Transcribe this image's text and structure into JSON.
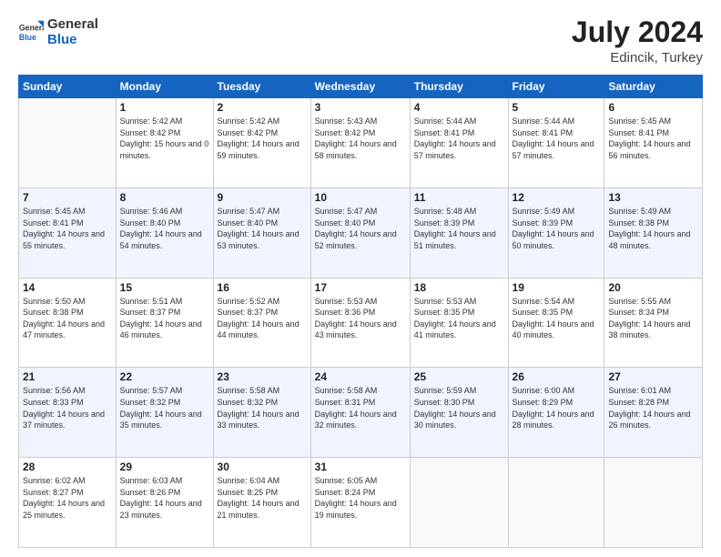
{
  "header": {
    "logo_general": "General",
    "logo_blue": "Blue",
    "month_year": "July 2024",
    "location": "Edincik, Turkey"
  },
  "weekdays": [
    "Sunday",
    "Monday",
    "Tuesday",
    "Wednesday",
    "Thursday",
    "Friday",
    "Saturday"
  ],
  "weeks": [
    [
      {
        "day": "",
        "sunrise": "",
        "sunset": "",
        "daylight": ""
      },
      {
        "day": "1",
        "sunrise": "5:42 AM",
        "sunset": "8:42 PM",
        "daylight": "15 hours and 0 minutes."
      },
      {
        "day": "2",
        "sunrise": "5:42 AM",
        "sunset": "8:42 PM",
        "daylight": "14 hours and 59 minutes."
      },
      {
        "day": "3",
        "sunrise": "5:43 AM",
        "sunset": "8:42 PM",
        "daylight": "14 hours and 58 minutes."
      },
      {
        "day": "4",
        "sunrise": "5:44 AM",
        "sunset": "8:41 PM",
        "daylight": "14 hours and 57 minutes."
      },
      {
        "day": "5",
        "sunrise": "5:44 AM",
        "sunset": "8:41 PM",
        "daylight": "14 hours and 57 minutes."
      },
      {
        "day": "6",
        "sunrise": "5:45 AM",
        "sunset": "8:41 PM",
        "daylight": "14 hours and 56 minutes."
      }
    ],
    [
      {
        "day": "7",
        "sunrise": "5:45 AM",
        "sunset": "8:41 PM",
        "daylight": "14 hours and 55 minutes."
      },
      {
        "day": "8",
        "sunrise": "5:46 AM",
        "sunset": "8:40 PM",
        "daylight": "14 hours and 54 minutes."
      },
      {
        "day": "9",
        "sunrise": "5:47 AM",
        "sunset": "8:40 PM",
        "daylight": "14 hours and 53 minutes."
      },
      {
        "day": "10",
        "sunrise": "5:47 AM",
        "sunset": "8:40 PM",
        "daylight": "14 hours and 52 minutes."
      },
      {
        "day": "11",
        "sunrise": "5:48 AM",
        "sunset": "8:39 PM",
        "daylight": "14 hours and 51 minutes."
      },
      {
        "day": "12",
        "sunrise": "5:49 AM",
        "sunset": "8:39 PM",
        "daylight": "14 hours and 50 minutes."
      },
      {
        "day": "13",
        "sunrise": "5:49 AM",
        "sunset": "8:38 PM",
        "daylight": "14 hours and 48 minutes."
      }
    ],
    [
      {
        "day": "14",
        "sunrise": "5:50 AM",
        "sunset": "8:38 PM",
        "daylight": "14 hours and 47 minutes."
      },
      {
        "day": "15",
        "sunrise": "5:51 AM",
        "sunset": "8:37 PM",
        "daylight": "14 hours and 46 minutes."
      },
      {
        "day": "16",
        "sunrise": "5:52 AM",
        "sunset": "8:37 PM",
        "daylight": "14 hours and 44 minutes."
      },
      {
        "day": "17",
        "sunrise": "5:53 AM",
        "sunset": "8:36 PM",
        "daylight": "14 hours and 43 minutes."
      },
      {
        "day": "18",
        "sunrise": "5:53 AM",
        "sunset": "8:35 PM",
        "daylight": "14 hours and 41 minutes."
      },
      {
        "day": "19",
        "sunrise": "5:54 AM",
        "sunset": "8:35 PM",
        "daylight": "14 hours and 40 minutes."
      },
      {
        "day": "20",
        "sunrise": "5:55 AM",
        "sunset": "8:34 PM",
        "daylight": "14 hours and 38 minutes."
      }
    ],
    [
      {
        "day": "21",
        "sunrise": "5:56 AM",
        "sunset": "8:33 PM",
        "daylight": "14 hours and 37 minutes."
      },
      {
        "day": "22",
        "sunrise": "5:57 AM",
        "sunset": "8:32 PM",
        "daylight": "14 hours and 35 minutes."
      },
      {
        "day": "23",
        "sunrise": "5:58 AM",
        "sunset": "8:32 PM",
        "daylight": "14 hours and 33 minutes."
      },
      {
        "day": "24",
        "sunrise": "5:58 AM",
        "sunset": "8:31 PM",
        "daylight": "14 hours and 32 minutes."
      },
      {
        "day": "25",
        "sunrise": "5:59 AM",
        "sunset": "8:30 PM",
        "daylight": "14 hours and 30 minutes."
      },
      {
        "day": "26",
        "sunrise": "6:00 AM",
        "sunset": "8:29 PM",
        "daylight": "14 hours and 28 minutes."
      },
      {
        "day": "27",
        "sunrise": "6:01 AM",
        "sunset": "8:28 PM",
        "daylight": "14 hours and 26 minutes."
      }
    ],
    [
      {
        "day": "28",
        "sunrise": "6:02 AM",
        "sunset": "8:27 PM",
        "daylight": "14 hours and 25 minutes."
      },
      {
        "day": "29",
        "sunrise": "6:03 AM",
        "sunset": "8:26 PM",
        "daylight": "14 hours and 23 minutes."
      },
      {
        "day": "30",
        "sunrise": "6:04 AM",
        "sunset": "8:25 PM",
        "daylight": "14 hours and 21 minutes."
      },
      {
        "day": "31",
        "sunrise": "6:05 AM",
        "sunset": "8:24 PM",
        "daylight": "14 hours and 19 minutes."
      },
      {
        "day": "",
        "sunrise": "",
        "sunset": "",
        "daylight": ""
      },
      {
        "day": "",
        "sunrise": "",
        "sunset": "",
        "daylight": ""
      },
      {
        "day": "",
        "sunrise": "",
        "sunset": "",
        "daylight": ""
      }
    ]
  ]
}
